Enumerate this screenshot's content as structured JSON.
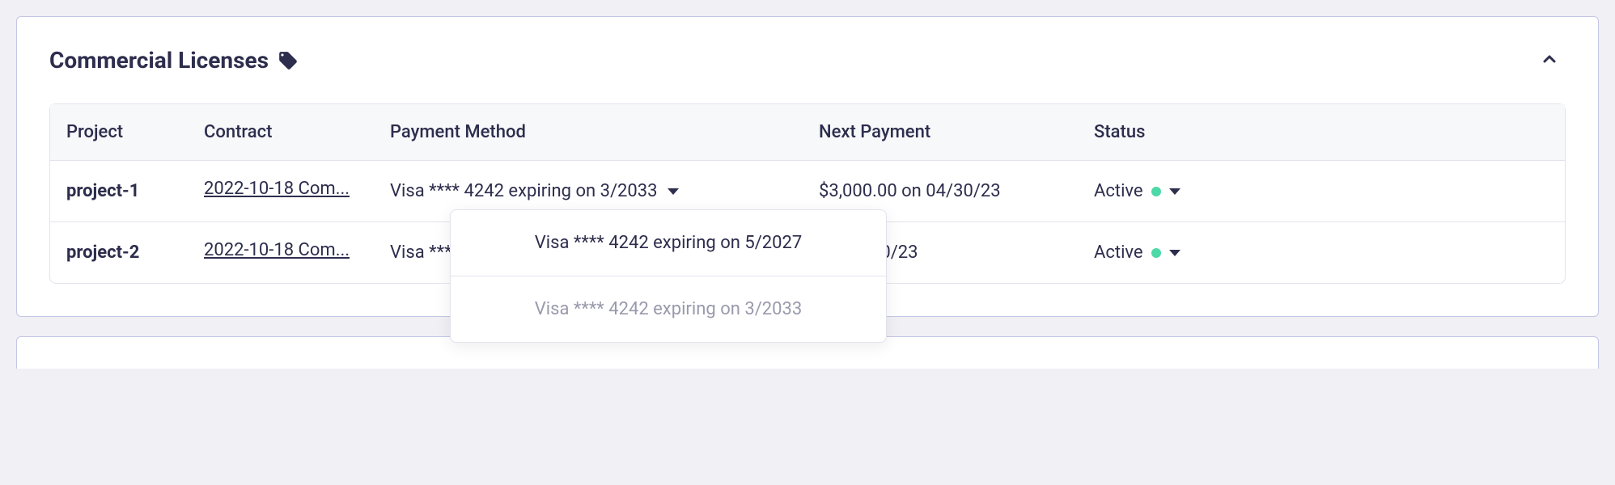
{
  "panel": {
    "title": "Commercial Licenses"
  },
  "columns": {
    "project": "Project",
    "contract": "Contract",
    "payment": "Payment Method",
    "next": "Next Payment",
    "status": "Status"
  },
  "rows": [
    {
      "project": "project-1",
      "contract": "2022-10-18 Com...",
      "payment": "Visa **** 4242 expiring on 3/2033",
      "next": "$3,000.00 on 04/30/23",
      "status": "Active"
    },
    {
      "project": "project-2",
      "contract": "2022-10-18 Com...",
      "payment": "Visa ****",
      "next": "on 04/30/23",
      "status": "Active"
    }
  ],
  "dropdown": {
    "options": [
      "Visa **** 4242 expiring on 5/2027",
      "Visa **** 4242 expiring on 3/2033"
    ]
  }
}
